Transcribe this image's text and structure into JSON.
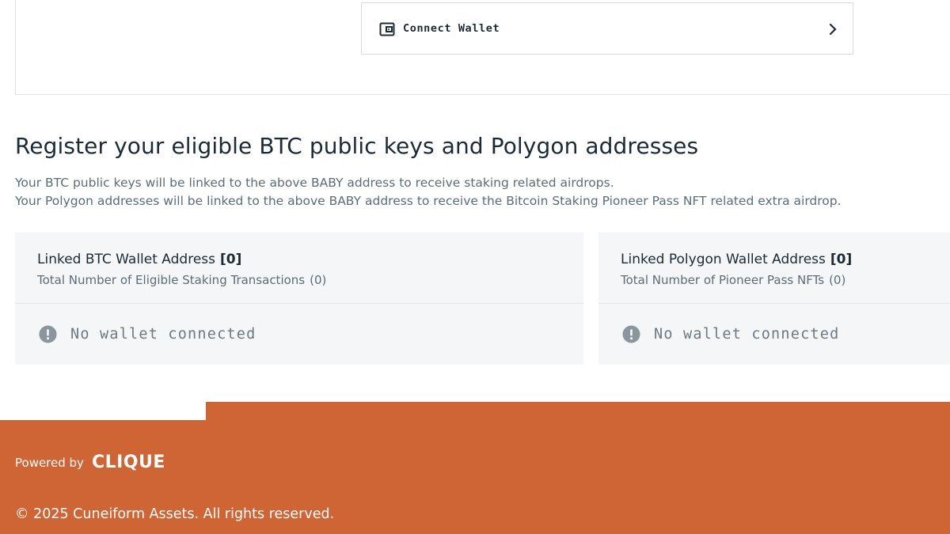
{
  "connect_wallet": {
    "label": "Connect Wallet"
  },
  "section": {
    "title": "Register your eligible BTC public keys and Polygon addresses",
    "desc_line1": "Your BTC public keys will be linked to the above BABY address to receive staking related airdrops.",
    "desc_line2": "Your Polygon addresses will be linked to the above BABY address to receive the Bitcoin Staking Pioneer Pass NFT related extra airdrop."
  },
  "btc_panel": {
    "title": "Linked BTC Wallet Address",
    "count": "[0]",
    "subtitle": "Total Number of Eligible Staking Transactions",
    "sub_count": "(0)",
    "status": "No wallet connected"
  },
  "polygon_panel": {
    "title": "Linked Polygon Wallet Address",
    "count": "[0]",
    "subtitle": "Total Number of Pioneer Pass NFTs",
    "sub_count": "(0)",
    "status": "No wallet connected"
  },
  "footer": {
    "powered_by": "Powered by",
    "logo_text": "CLIQUE",
    "copyright": "© 2025 Cuneiform Assets. All rights reserved."
  },
  "colors": {
    "footer_bg": "#cf6434",
    "panel_bg": "#f4f6f8",
    "text_dark": "#1b2b36",
    "text_muted": "#5d6c75"
  },
  "icons": {
    "connect": "wallet-icon",
    "chevron": "chevron-right-icon",
    "status": "alert-circle-icon"
  }
}
